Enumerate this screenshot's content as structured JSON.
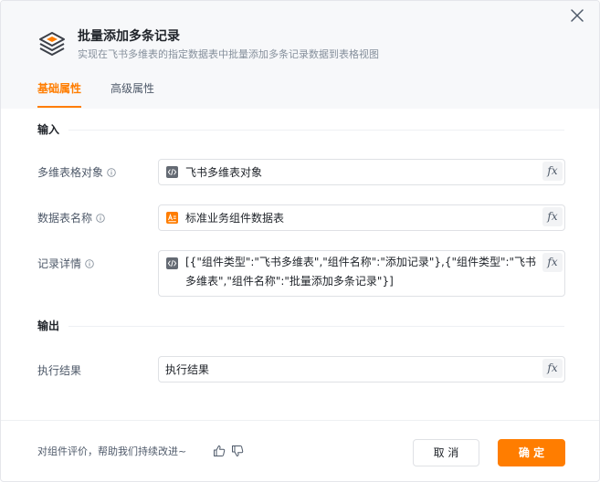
{
  "header": {
    "title": "批量添加多条记录",
    "subtitle": "实现在飞书多维表的指定数据表中批量添加多条记录数据到表格视图"
  },
  "tabs": [
    {
      "label": "基础属性",
      "active": true
    },
    {
      "label": "高级属性",
      "active": false
    }
  ],
  "sections": {
    "input_title": "输入",
    "output_title": "输出"
  },
  "fields": {
    "table_object": {
      "label": "多维表格对象",
      "value": "飞书多维表对象",
      "icon": "code-variable-icon"
    },
    "table_name": {
      "label": "数据表名称",
      "value": "标准业务组件数据表",
      "icon": "text-type-icon"
    },
    "records": {
      "label": "记录详情",
      "value": "[{\"组件类型\":\"飞书多维表\",\"组件名称\":\"添加记录\"},{\"组件类型\":\"飞书多维表\",\"组件名称\":\"批量添加多条记录\"}]",
      "icon": "code-variable-icon"
    },
    "result": {
      "label": "执行结果",
      "value": "执行结果"
    }
  },
  "fx_label": "fx",
  "footer": {
    "feedback": "对组件评价，帮助我们持续改进~",
    "cancel_label": "取 消",
    "ok_label": "确 定"
  },
  "colors": {
    "accent": "#ff7d00",
    "text_type_icon": "#ff7d00",
    "code_icon_bg": "#646a73"
  }
}
